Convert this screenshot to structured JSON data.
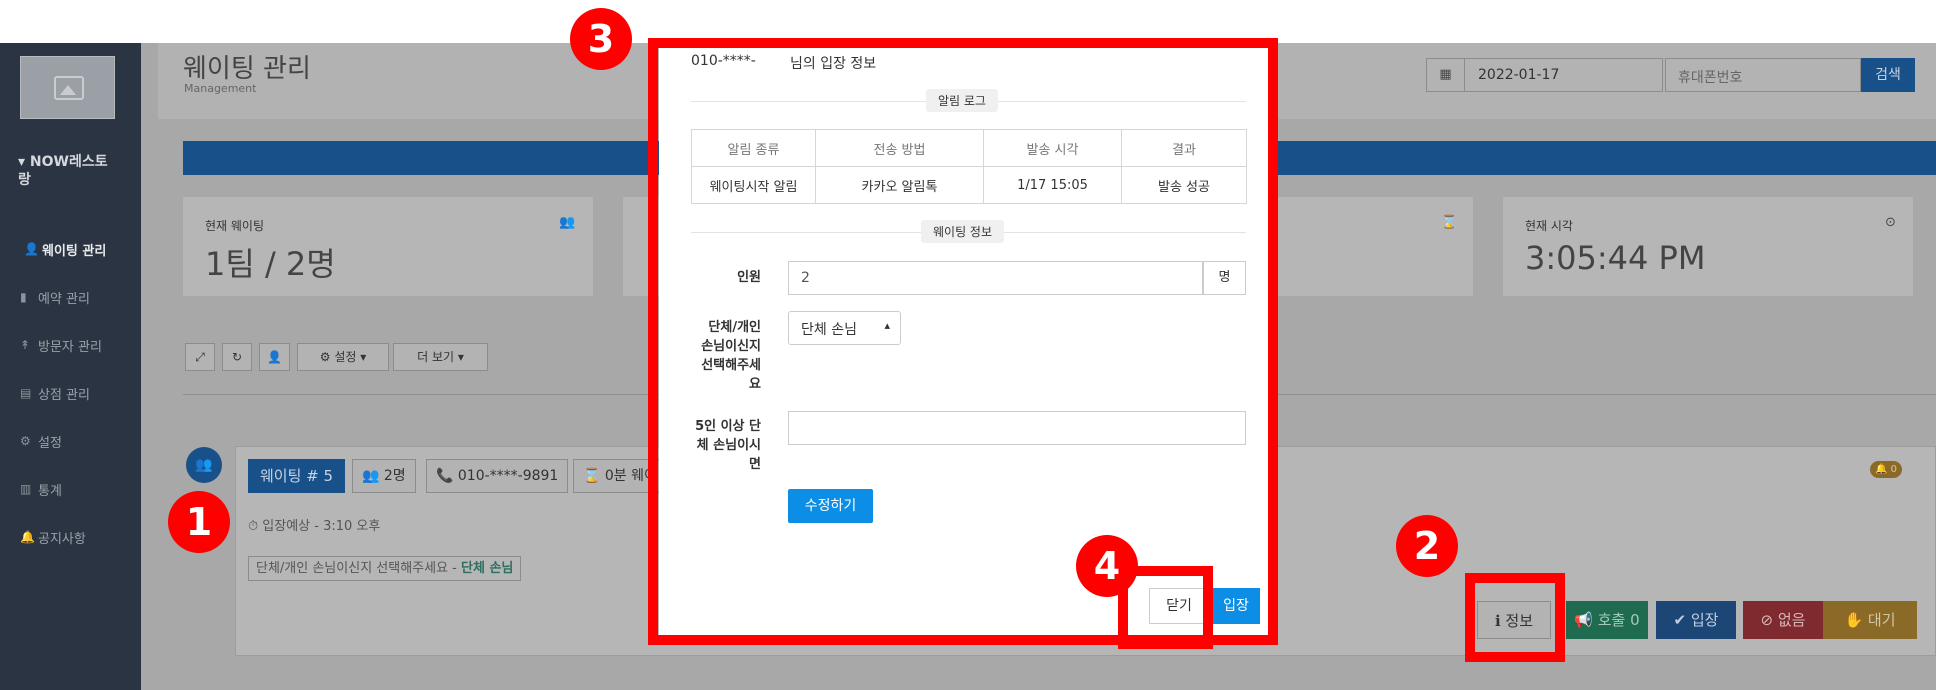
{
  "header": {
    "title": "웨이팅 관리",
    "subtitle": "Management",
    "date_value": "2022-01-17",
    "phone_placeholder": "휴대폰번호",
    "search_label": "검색"
  },
  "sidebar": {
    "brand": "▾ NOW레스토랑",
    "items": [
      {
        "label": "웨이팅 관리",
        "icon": "user-plus-icon"
      },
      {
        "label": "예약 관리",
        "icon": "bookmark-icon"
      },
      {
        "label": "방문자 관리",
        "icon": "walker-icon"
      },
      {
        "label": "상점 관리",
        "icon": "building-icon"
      },
      {
        "label": "설정",
        "icon": "gear-icon"
      },
      {
        "label": "통계",
        "icon": "chart-icon"
      },
      {
        "label": "공지사항",
        "icon": "bell-icon"
      }
    ]
  },
  "stats": {
    "current_waiting_label": "현재 웨이팅",
    "current_waiting_value": "1팀 / 2명",
    "current_time_label": "현재 시각",
    "current_time_value": "3:05:44 PM"
  },
  "toolbar": {
    "settings_label": "⚙ 설정 ▾",
    "more_label": "더 보기 ▾"
  },
  "waiting_entry": {
    "number_label": "웨이팅 # 5",
    "people": "👥 2명",
    "phone": "📞 010-****-9891",
    "wait_time": "⌛ 0분 웨이",
    "eta": "⏱ 입장예상 - 3:10 오후",
    "choice_text": "단체/개인 손님이신지 선택해주세요 - ",
    "choice_value": "단체 손님",
    "bell_count": "🔔 0",
    "actions": {
      "info": "ℹ 정보",
      "call": "📢 호출 0",
      "enter": "✔ 입장",
      "none": "⊘ 없음",
      "wait": "✋ 대기"
    }
  },
  "modal": {
    "phone": "010-****-",
    "title": "님의 입장 정보",
    "log_section": "알림 로그",
    "table_headers": [
      "알림 종류",
      "전송 방법",
      "발송 시각",
      "결과"
    ],
    "table_rows": [
      [
        "웨이팅시작 알림",
        "카카오 알림톡",
        "1/17 15:05",
        "발송 성공"
      ]
    ],
    "info_section": "웨이팅 정보",
    "people_label": "인원",
    "people_value": "2",
    "people_unit": "명",
    "group_label": "단체/개인 손님이신지 선택해주세요",
    "group_value": "단체 손님",
    "large_group_label": "5인 이상 단체 손님이시면",
    "large_group_value": "",
    "edit_label": "수정하기",
    "close_label": "닫기",
    "enter_label": "입장"
  },
  "annotations": [
    "1",
    "2",
    "3",
    "4"
  ],
  "colors": {
    "annotation": "#ff0000",
    "primary_blue": "#0d8ee6",
    "sidebar_bg": "#2b3442"
  }
}
